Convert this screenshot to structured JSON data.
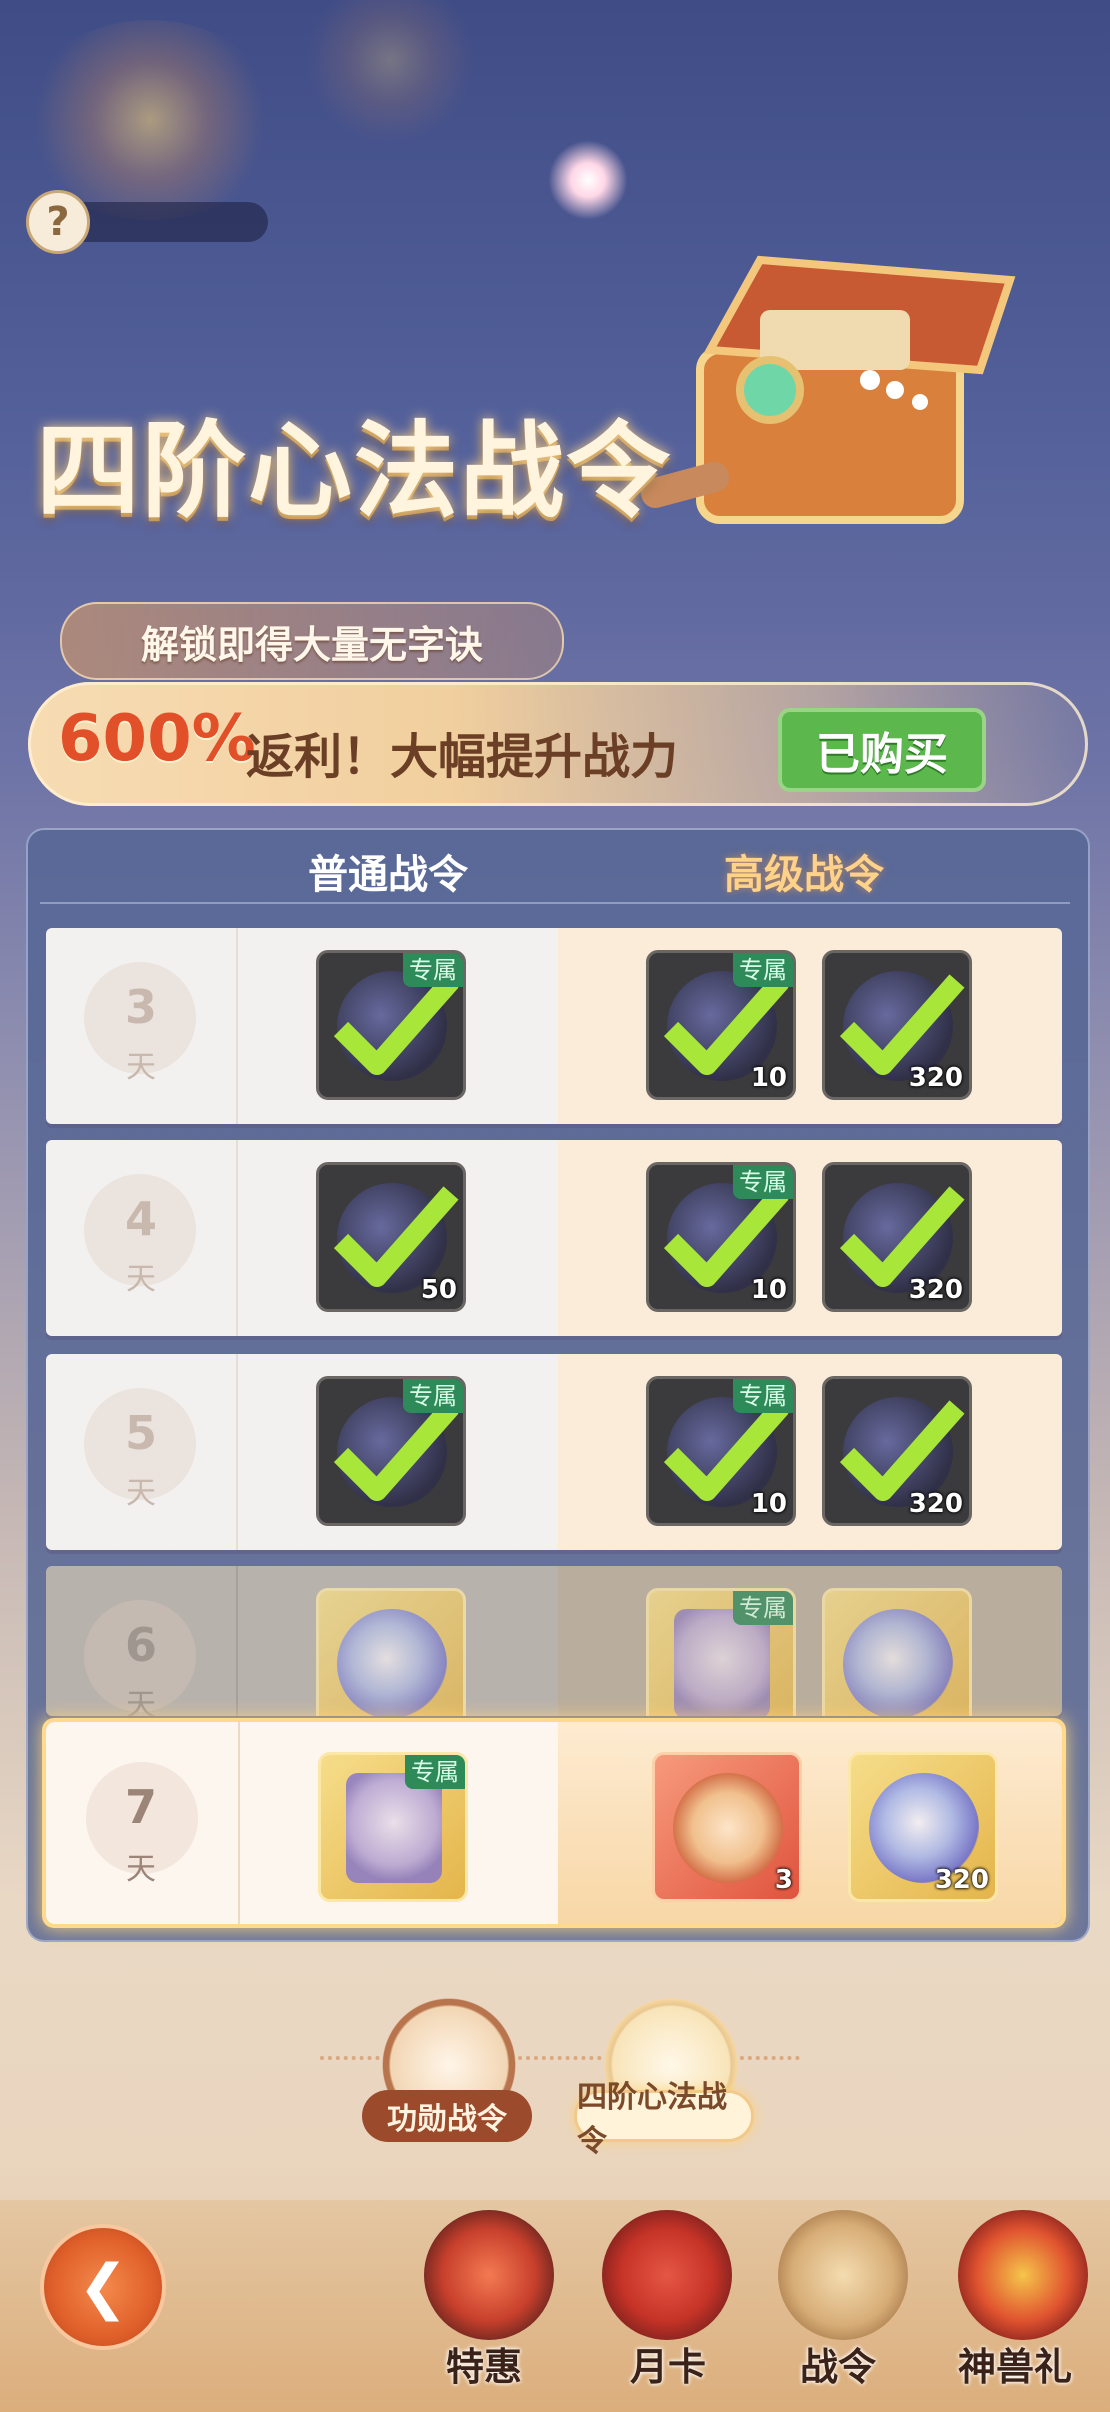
{
  "header": {
    "help_label": "?",
    "title": "四阶心法战令",
    "subtitle": "解锁即得大量无字诀",
    "promo_percent": "600%",
    "promo_text": "返利！大幅提升战力",
    "bought_label": "已购买"
  },
  "table": {
    "col_normal": "普通战令",
    "col_advanced": "高级战令",
    "day_unit": "天",
    "exclusive_tag": "专属",
    "rows": [
      {
        "day": "3",
        "normal": {
          "qty": ""
        },
        "adv1": {
          "qty": "10"
        },
        "adv2": {
          "qty": "320"
        }
      },
      {
        "day": "4",
        "normal": {
          "qty": "50"
        },
        "adv1": {
          "qty": "10"
        },
        "adv2": {
          "qty": "320"
        }
      },
      {
        "day": "5",
        "normal": {
          "qty": ""
        },
        "adv1": {
          "qty": "10"
        },
        "adv2": {
          "qty": "320"
        }
      },
      {
        "day": "6",
        "normal": {
          "qty": ""
        },
        "adv1": {
          "qty": ""
        },
        "adv2": {
          "qty": ""
        }
      },
      {
        "day": "7",
        "normal": {
          "qty": ""
        },
        "adv1": {
          "qty": "3"
        },
        "adv2": {
          "qty": "320"
        }
      }
    ]
  },
  "tabs": {
    "tab1": "功勋战令",
    "tab2": "四阶心法战令"
  },
  "nav": {
    "back_icon": "arrow-left-icon",
    "items": [
      "特惠",
      "月卡",
      "战令",
      "神兽礼"
    ]
  },
  "colors": {
    "accent_green": "#5cb74c",
    "promo_red": "#e2502a",
    "tag_green": "#2f8a5a"
  }
}
